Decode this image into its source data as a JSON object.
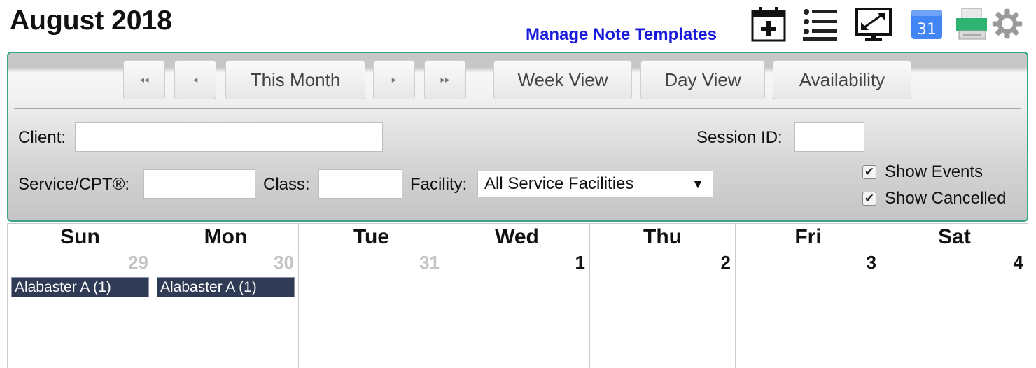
{
  "header": {
    "title": "August 2018",
    "manage_link": "Manage Note Templates"
  },
  "toolbar_icons": [
    "add-appointment-icon",
    "list-view-icon",
    "fullscreen-icon",
    "google-calendar-icon",
    "print-icon",
    "settings-gear-icon"
  ],
  "google_calendar_icon_text": "31",
  "colors": {
    "panel_border": "#3aa58a",
    "link": "#1a1adb",
    "event_bg": "#2f3b55",
    "google_blue": "#4285f4",
    "printer_green": "#2fb371"
  },
  "nav": {
    "first_glyph": "◂◂",
    "prev_glyph": "◂",
    "this_month": "This Month",
    "next_glyph": "▸",
    "last_glyph": "▸▸",
    "week_view": "Week View",
    "day_view": "Day View",
    "availability": "Availability"
  },
  "filters": {
    "client_label": "Client:",
    "client_value": "",
    "session_label": "Session ID:",
    "session_value": "",
    "service_label": "Service/CPT®:",
    "service_value": "",
    "class_label": "Class:",
    "class_value": "",
    "facility_label": "Facility:",
    "facility_selected": "All Service Facilities",
    "show_events": "Show Events",
    "show_events_checked": true,
    "show_cancelled": "Show Cancelled",
    "show_cancelled_checked": true
  },
  "calendar": {
    "weekdays": [
      "Sun",
      "Mon",
      "Tue",
      "Wed",
      "Thu",
      "Fri",
      "Sat"
    ],
    "days": [
      {
        "num": "29",
        "other_month": true,
        "events": [
          "Alabaster A (1)"
        ]
      },
      {
        "num": "30",
        "other_month": true,
        "events": [
          "Alabaster A (1)"
        ]
      },
      {
        "num": "31",
        "other_month": true,
        "events": []
      },
      {
        "num": "1",
        "other_month": false,
        "events": []
      },
      {
        "num": "2",
        "other_month": false,
        "events": []
      },
      {
        "num": "3",
        "other_month": false,
        "events": []
      },
      {
        "num": "4",
        "other_month": false,
        "events": []
      }
    ]
  }
}
